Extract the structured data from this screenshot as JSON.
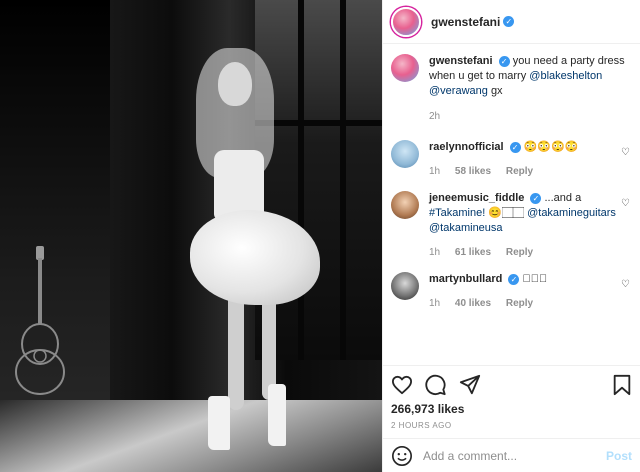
{
  "header": {
    "username": "gwenstefani"
  },
  "caption": {
    "username": "gwenstefani",
    "text": "you need a party dress when u get to marry",
    "mention1": "@blakeshelton",
    "mention2": "@verawang",
    "tail": "gx",
    "time": "2h"
  },
  "comments": [
    {
      "username": "raelynnofficial",
      "text": "😳😳😳😳",
      "time": "1h",
      "likes": "58 likes",
      "reply": "Reply"
    },
    {
      "username": "jeneemusic_fiddle",
      "text": "...and a",
      "hashtag": "#Takamine!",
      "emoji": "😊🏻🏻",
      "mention1": "@takamineguitars",
      "mention2": "@takamineusa",
      "time": "1h",
      "likes": "61 likes",
      "reply": "Reply"
    },
    {
      "username": "martynbullard",
      "text": "🏻🏻🏻",
      "time": "1h",
      "likes": "40 likes",
      "reply": "Reply"
    }
  ],
  "actions": {
    "likes": "266,973 likes",
    "ago": "2 HOURS AGO"
  },
  "add_comment": {
    "placeholder": "Add a comment...",
    "post_label": "Post"
  },
  "icons": [
    "heart-icon",
    "comment-icon",
    "share-icon",
    "bookmark-icon",
    "emoji-icon",
    "verified-badge-icon"
  ],
  "colors": {
    "verified": "#3897f0",
    "link": "#00376b",
    "muted": "#8e8e8e",
    "post_disabled": "#b2dffc"
  }
}
